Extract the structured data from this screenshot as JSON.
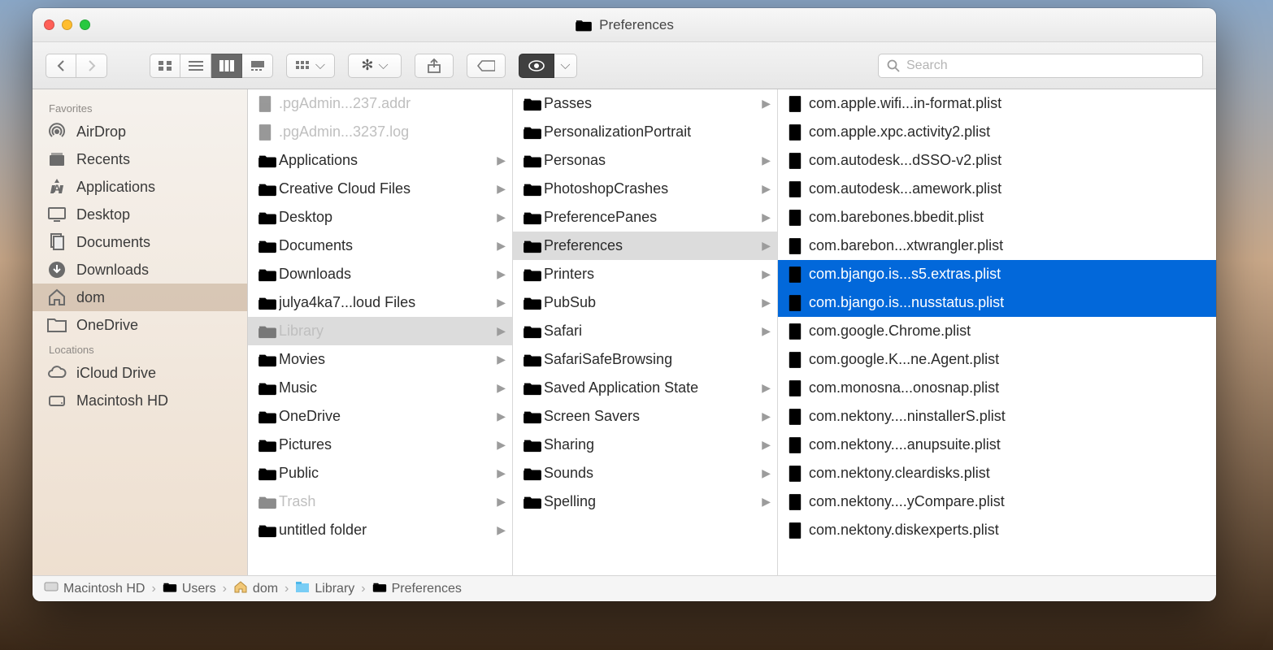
{
  "window_title": "Preferences",
  "search": {
    "placeholder": "Search"
  },
  "sidebar": {
    "sections": [
      {
        "header": "Favorites",
        "items": [
          {
            "label": "AirDrop",
            "icon": "airdrop"
          },
          {
            "label": "Recents",
            "icon": "recents"
          },
          {
            "label": "Applications",
            "icon": "apps"
          },
          {
            "label": "Desktop",
            "icon": "desktop"
          },
          {
            "label": "Documents",
            "icon": "docs"
          },
          {
            "label": "Downloads",
            "icon": "downloads"
          },
          {
            "label": "dom",
            "icon": "home",
            "selected": true
          },
          {
            "label": "OneDrive",
            "icon": "folder"
          }
        ]
      },
      {
        "header": "Locations",
        "items": [
          {
            "label": "iCloud Drive",
            "icon": "icloud"
          },
          {
            "label": "Macintosh HD",
            "icon": "disk"
          }
        ]
      }
    ]
  },
  "columns": [
    {
      "items": [
        {
          "label": ".pgAdmin...237.addr",
          "type": "file-dim"
        },
        {
          "label": ".pgAdmin...3237.log",
          "type": "file-dim"
        },
        {
          "label": "Applications",
          "type": "folder",
          "hasChildren": true
        },
        {
          "label": "Creative Cloud Files",
          "type": "folder",
          "hasChildren": true
        },
        {
          "label": "Desktop",
          "type": "folder",
          "hasChildren": true
        },
        {
          "label": "Documents",
          "type": "folder",
          "hasChildren": true
        },
        {
          "label": "Downloads",
          "type": "folder",
          "hasChildren": true
        },
        {
          "label": "julya4ka7...loud Files",
          "type": "folder",
          "hasChildren": true
        },
        {
          "label": "Library",
          "type": "folder-dim",
          "hasChildren": true,
          "state": "grey"
        },
        {
          "label": "Movies",
          "type": "folder",
          "hasChildren": true
        },
        {
          "label": "Music",
          "type": "folder",
          "hasChildren": true
        },
        {
          "label": "OneDrive",
          "type": "folder",
          "hasChildren": true
        },
        {
          "label": "Pictures",
          "type": "folder",
          "hasChildren": true
        },
        {
          "label": "Public",
          "type": "folder",
          "hasChildren": true
        },
        {
          "label": "Trash",
          "type": "folder-dim",
          "hasChildren": true
        },
        {
          "label": "untitled folder",
          "type": "folder",
          "hasChildren": true
        }
      ]
    },
    {
      "items": [
        {
          "label": "Passes",
          "type": "folder",
          "hasChildren": true
        },
        {
          "label": "PersonalizationPortrait",
          "type": "folder"
        },
        {
          "label": "Personas",
          "type": "folder",
          "hasChildren": true
        },
        {
          "label": "PhotoshopCrashes",
          "type": "folder",
          "hasChildren": true
        },
        {
          "label": "PreferencePanes",
          "type": "folder",
          "hasChildren": true
        },
        {
          "label": "Preferences",
          "type": "folder",
          "hasChildren": true,
          "state": "grey"
        },
        {
          "label": "Printers",
          "type": "folder",
          "hasChildren": true
        },
        {
          "label": "PubSub",
          "type": "folder",
          "hasChildren": true
        },
        {
          "label": "Safari",
          "type": "folder",
          "hasChildren": true
        },
        {
          "label": "SafariSafeBrowsing",
          "type": "folder"
        },
        {
          "label": "Saved Application State",
          "type": "folder",
          "hasChildren": true
        },
        {
          "label": "Screen Savers",
          "type": "folder",
          "hasChildren": true
        },
        {
          "label": "Sharing",
          "type": "folder",
          "hasChildren": true
        },
        {
          "label": "Sounds",
          "type": "folder",
          "hasChildren": true
        },
        {
          "label": "Spelling",
          "type": "folder",
          "hasChildren": true
        }
      ]
    },
    {
      "items": [
        {
          "label": "com.apple.wifi...in-format.plist",
          "type": "plist"
        },
        {
          "label": "com.apple.xpc.activity2.plist",
          "type": "plist"
        },
        {
          "label": "com.autodesk...dSSO-v2.plist",
          "type": "plist"
        },
        {
          "label": "com.autodesk...amework.plist",
          "type": "plist"
        },
        {
          "label": "com.barebones.bbedit.plist",
          "type": "plist"
        },
        {
          "label": "com.barebon...xtwrangler.plist",
          "type": "plist"
        },
        {
          "label": "com.bjango.is...s5.extras.plist",
          "type": "plist",
          "state": "blue"
        },
        {
          "label": "com.bjango.is...nusstatus.plist",
          "type": "plist",
          "state": "blue"
        },
        {
          "label": "com.google.Chrome.plist",
          "type": "plist"
        },
        {
          "label": "com.google.K...ne.Agent.plist",
          "type": "plist"
        },
        {
          "label": "com.monosna...onosnap.plist",
          "type": "plist"
        },
        {
          "label": "com.nektony....ninstallerS.plist",
          "type": "plist"
        },
        {
          "label": "com.nektony....anupsuite.plist",
          "type": "plist"
        },
        {
          "label": "com.nektony.cleardisks.plist",
          "type": "plist"
        },
        {
          "label": "com.nektony....yCompare.plist",
          "type": "plist"
        },
        {
          "label": "com.nektony.diskexperts.plist",
          "type": "plist"
        }
      ]
    }
  ],
  "pathbar": [
    {
      "label": "Macintosh HD",
      "icon": "disk"
    },
    {
      "label": "Users",
      "icon": "folder"
    },
    {
      "label": "dom",
      "icon": "home"
    },
    {
      "label": "Library",
      "icon": "library"
    },
    {
      "label": "Preferences",
      "icon": "folder"
    }
  ]
}
